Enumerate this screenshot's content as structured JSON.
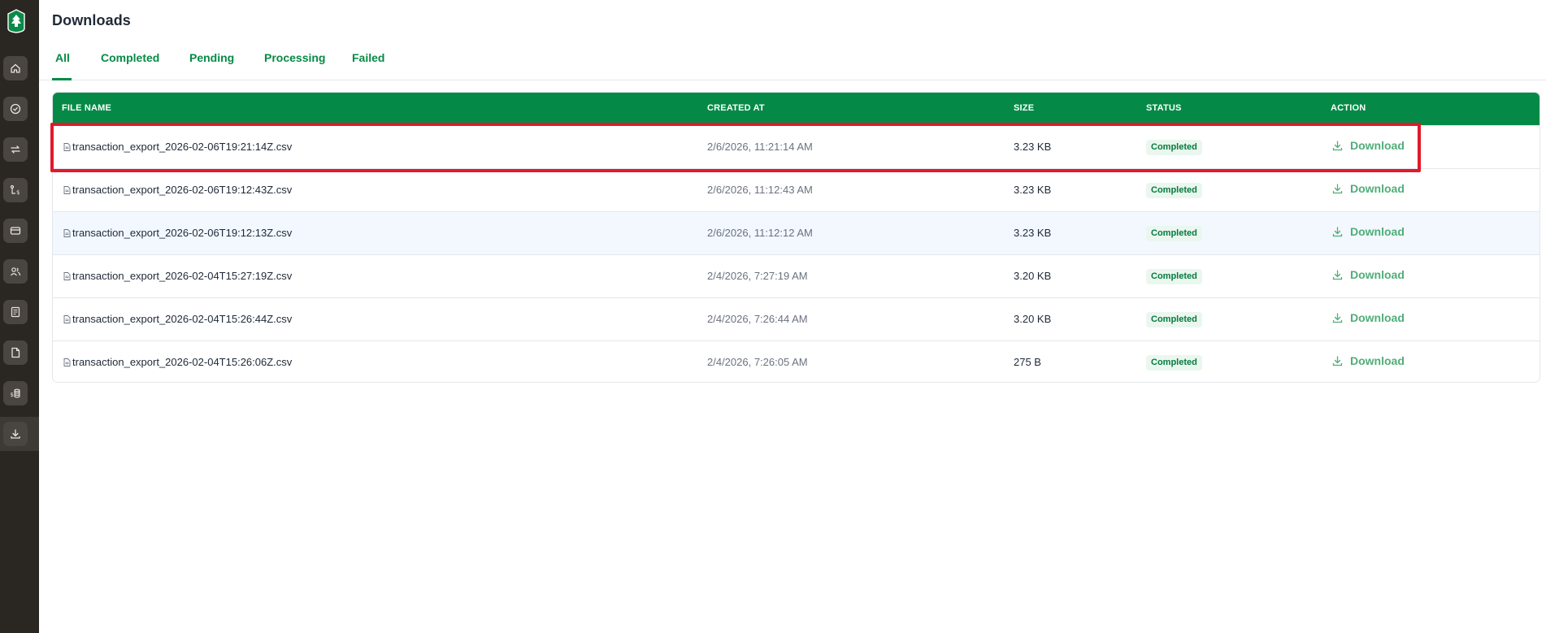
{
  "app": {
    "name": "Downloads"
  },
  "sidebar": {
    "items": [
      {
        "name": "home-icon",
        "label": "Home"
      },
      {
        "name": "check-circle-icon",
        "label": "Approvals"
      },
      {
        "name": "transfer-arrows-icon",
        "label": "Transfers"
      },
      {
        "name": "route-dollar-icon",
        "label": "Payments"
      },
      {
        "name": "card-icon",
        "label": "Cards"
      },
      {
        "name": "users-icon",
        "label": "Users"
      },
      {
        "name": "receipt-icon",
        "label": "Statements"
      },
      {
        "name": "document-icon",
        "label": "Documents"
      },
      {
        "name": "dollar-stack-icon",
        "label": "Accounts"
      },
      {
        "name": "download-icon",
        "label": "Downloads",
        "active": true
      }
    ]
  },
  "tabs": [
    {
      "label": "All",
      "active": true
    },
    {
      "label": "Completed"
    },
    {
      "label": "Pending"
    },
    {
      "label": "Processing"
    },
    {
      "label": "Failed"
    }
  ],
  "table": {
    "columns": [
      "FILE NAME",
      "CREATED AT",
      "SIZE",
      "STATUS",
      "ACTION"
    ],
    "rows": [
      {
        "file": "transaction_export_2026-02-06T19:21:14Z.csv",
        "created": "2/6/2026, 11:21:14 AM",
        "size": "3.23 KB",
        "status": "Completed",
        "action": "Download"
      },
      {
        "file": "transaction_export_2026-02-06T19:12:43Z.csv",
        "created": "2/6/2026, 11:12:43 AM",
        "size": "3.23 KB",
        "status": "Completed",
        "action": "Download"
      },
      {
        "file": "transaction_export_2026-02-06T19:12:13Z.csv",
        "created": "2/6/2026, 11:12:12 AM",
        "size": "3.23 KB",
        "status": "Completed",
        "action": "Download"
      },
      {
        "file": "transaction_export_2026-02-04T15:27:19Z.csv",
        "created": "2/4/2026, 7:27:19 AM",
        "size": "3.20 KB",
        "status": "Completed",
        "action": "Download"
      },
      {
        "file": "transaction_export_2026-02-04T15:26:44Z.csv",
        "created": "2/4/2026, 7:26:44 AM",
        "size": "3.20 KB",
        "status": "Completed",
        "action": "Download"
      },
      {
        "file": "transaction_export_2026-02-04T15:26:06Z.csv",
        "created": "2/4/2026, 7:26:05 AM",
        "size": "275 B",
        "status": "Completed",
        "action": "Download"
      }
    ]
  },
  "colors": {
    "brand_green": "#048a46",
    "sidebar_bg": "#2a2622",
    "highlight_red": "#e01a2b",
    "status_bg": "#eaf7ef"
  }
}
